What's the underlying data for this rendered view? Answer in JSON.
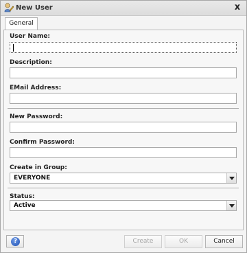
{
  "window": {
    "title": "New User",
    "close_glyph": "x",
    "title_icon": "user-edit-icon"
  },
  "tabs": [
    {
      "label": "General",
      "selected": true
    }
  ],
  "form": {
    "user_name": {
      "label": "User Name:",
      "value": ""
    },
    "description": {
      "label": "Description:",
      "value": ""
    },
    "email": {
      "label": "EMail Address:",
      "value": ""
    },
    "new_password": {
      "label": "New Password:",
      "value": ""
    },
    "confirm_password": {
      "label": "Confirm Password:",
      "value": ""
    },
    "group": {
      "label": "Create in Group:",
      "value": "EVERYONE"
    },
    "status": {
      "label": "Status:",
      "value": "Active"
    }
  },
  "footer": {
    "help_glyph": "?",
    "create_label": "Create",
    "ok_label": "OK",
    "cancel_label": "Cancel"
  },
  "colors": {
    "help_icon": "#1d4fb3",
    "disabled_text": "#a5a5a5"
  }
}
